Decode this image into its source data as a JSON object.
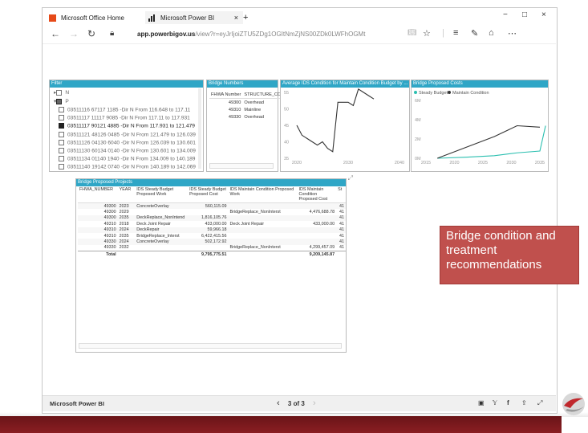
{
  "browser": {
    "tabs": [
      {
        "label": "Microsoft Office Home"
      },
      {
        "label": "Microsoft Power BI"
      }
    ],
    "new_tab": "+",
    "url_host": "app.powerbigov.us",
    "url_path": "/view?r=eyJrIjoiZTU5ZDg1OGItNmZjNS00ZDk0LWFhOGMtNDMwMmI0N2Y1YmYzIiwidCI6ImIxZTY1ZmNjLTMyZmEtNGZkZC04N",
    "window_controls": [
      "−",
      "□",
      "×"
    ]
  },
  "filter": {
    "title": "Filter",
    "groups": [
      "N",
      "P"
    ],
    "items": [
      {
        "label": "03511116 67117 1185 -Dir N From 116.648 to 117.11",
        "checked": false
      },
      {
        "label": "03511117 11117 9085 -Dir N From 117.11 to 117.931",
        "checked": false
      },
      {
        "label": "03511117 90121 4885 -Dir N From 117.931 to 121.479",
        "checked": true
      },
      {
        "label": "03511121 48126 0485 -Dir N From 121.479 to 126.039",
        "checked": false
      },
      {
        "label": "03511126 04130 6040 -Dir N From 126.039 to 130.601",
        "checked": false
      },
      {
        "label": "03511130 60134 0140 -Dir N From 130.601 to 134.009",
        "checked": false
      },
      {
        "label": "03511134 01140 1940 -Dir N From 134.009 to 140.189",
        "checked": false
      },
      {
        "label": "03511140 19142 0740 -Dir N From 140.189 to 142.069",
        "checked": false
      }
    ]
  },
  "bridge_numbers": {
    "title": "Bridge Numbers",
    "columns": [
      "FHWA Number",
      "STRUCTURE_CO"
    ],
    "rows": [
      [
        "49300",
        "Overhead"
      ],
      [
        "49310",
        "Mainline"
      ],
      [
        "49330",
        "Overhead"
      ]
    ]
  },
  "chart_data": [
    {
      "type": "line",
      "title": "Average IDS Condition for Maintain Condition Budget by ...",
      "x": [
        2020,
        2021,
        2022,
        2023,
        2024,
        2025,
        2026,
        2027,
        2028,
        2029,
        2030,
        2031,
        2032,
        2033,
        2034,
        2035
      ],
      "series": [
        {
          "values": [
            45,
            42,
            41,
            40,
            39,
            40,
            38,
            37,
            52,
            52,
            52,
            51,
            56,
            55,
            54,
            53
          ]
        }
      ],
      "xlim": [
        2020,
        2040
      ],
      "ylim": [
        35,
        55
      ],
      "xticks": [
        "2020",
        "2030",
        "2040"
      ],
      "yticks": [
        "35",
        "40",
        "45",
        "50",
        "55"
      ]
    },
    {
      "type": "line",
      "title": "Bridge Proposed Costs",
      "legend": [
        "Steady Budget",
        "Maintain Condition"
      ],
      "x": [
        2017,
        2022,
        2027,
        2031,
        2035,
        2036
      ],
      "series": [
        {
          "name": "Steady Budget",
          "values": [
            0.0,
            0.15,
            0.35,
            0.75,
            1.0,
            4.5
          ]
        },
        {
          "name": "Maintain Condition",
          "values": [
            0.0,
            1.5,
            3.0,
            4.5,
            4.3,
            null
          ]
        }
      ],
      "xlim": [
        2015,
        2035
      ],
      "ylim": [
        0,
        8
      ],
      "xticks": [
        "2015",
        "2020",
        "2025",
        "2030",
        "2035"
      ],
      "yticks": [
        "0M",
        "2M",
        "4M",
        "6M"
      ],
      "colors": {
        "Steady Budget": "#2bbfb0",
        "Maintain Condition": "#333333"
      }
    }
  ],
  "projects": {
    "title": "Bridge Proposed Projects",
    "columns": [
      "FHWA_NUMBER",
      "YEAR",
      "IDS Steady Budget Proposed Work",
      "IDS Steady Budget Proposed Cost",
      "IDS Maintain Condition Proposed Work",
      "IDS Maintain Condition Proposed Cost",
      "St"
    ],
    "rows": [
      [
        "49300",
        "2023",
        "ConcreteOverlay",
        "560,115.09",
        "",
        "",
        "41"
      ],
      [
        "49300",
        "2029",
        "",
        "",
        "BridgeReplace_NonInterst",
        "4,476,688.78",
        "41"
      ],
      [
        "49300",
        "2035",
        "DeckReplace_NonIntend",
        "1,816,105.76",
        "",
        "",
        "41"
      ],
      [
        "49310",
        "2018",
        "Deck Joint Repair",
        "433,000.00",
        "Deck Joint Repair",
        "433,000.00",
        "41"
      ],
      [
        "49310",
        "2024",
        "DeckRepair",
        "59,966.18",
        "",
        "",
        "41"
      ],
      [
        "49310",
        "2035",
        "BridgeReplace_Interst",
        "6,422,415.56",
        "",
        "",
        "41"
      ],
      [
        "49330",
        "2024",
        "ConcreteOverlay",
        "502,172.92",
        "",
        "",
        "41"
      ],
      [
        "49330",
        "2032",
        "",
        "",
        "BridgeReplace_NonInterst",
        "4,299,457.09",
        "41"
      ]
    ],
    "total": [
      "Total",
      "",
      "",
      "9,795,775.51",
      "",
      "9,209,145.87",
      ""
    ]
  },
  "callout": {
    "text": "Bridge condition and treatment recommendations"
  },
  "footer": {
    "brand": "Microsoft Power BI",
    "pager": "3 of 3",
    "prev": "‹",
    "next": "›"
  }
}
